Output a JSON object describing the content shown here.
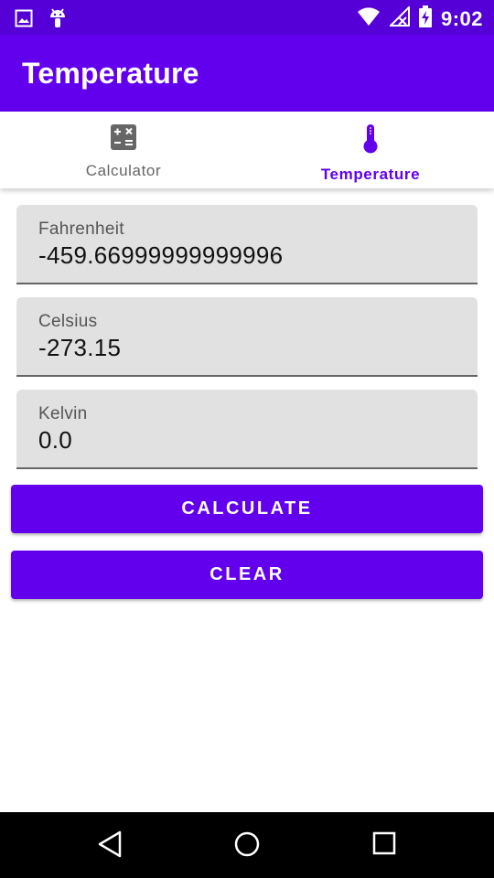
{
  "status_bar": {
    "time": "9:02",
    "icons": [
      "image-icon",
      "android-icon",
      "wifi-icon",
      "no-signal-icon",
      "battery-charging-icon"
    ]
  },
  "app_bar": {
    "title": "Temperature"
  },
  "tabs": [
    {
      "label": "Calculator",
      "icon": "calculator-icon",
      "selected": false
    },
    {
      "label": "Temperature",
      "icon": "thermometer-icon",
      "selected": true
    }
  ],
  "fields": {
    "fahrenheit": {
      "label": "Fahrenheit",
      "value": "-459.66999999999996"
    },
    "celsius": {
      "label": "Celsius",
      "value": "-273.15"
    },
    "kelvin": {
      "label": "Kelvin",
      "value": "0.0"
    }
  },
  "buttons": {
    "calculate": "CALCULATE",
    "clear": "CLEAR"
  },
  "colors": {
    "primary": "#6200ee",
    "primary_dark": "#5500d6",
    "field_bg": "#e1e1e1"
  }
}
